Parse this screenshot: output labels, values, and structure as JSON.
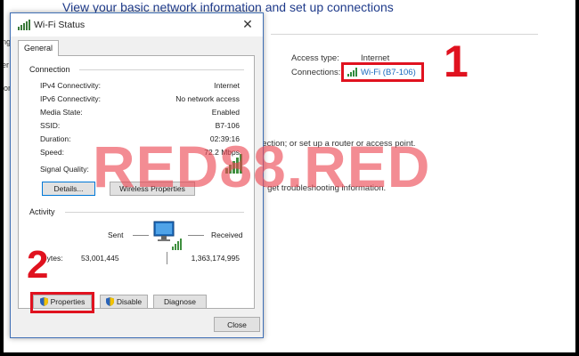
{
  "background": {
    "heading": "View your basic network information and set up connections",
    "left_fragments": [
      "ngs",
      "er",
      "ion"
    ],
    "access_type_label": "Access type:",
    "access_type_value": "Internet",
    "connections_label": "Connections:",
    "connection_link": "Wi-Fi (B7-106)",
    "text1": "nection; or set up a router or access point.",
    "text2": "or get troubleshooting information."
  },
  "dialog": {
    "title": "Wi-Fi Status",
    "tab": "General",
    "connection_section": "Connection",
    "rows": [
      {
        "label": "IPv4 Connectivity:",
        "value": "Internet"
      },
      {
        "label": "IPv6 Connectivity:",
        "value": "No network access"
      },
      {
        "label": "Media State:",
        "value": "Enabled"
      },
      {
        "label": "SSID:",
        "value": "B7-106"
      },
      {
        "label": "Duration:",
        "value": "02:39:16"
      },
      {
        "label": "Speed:",
        "value": "72.2 Mbps"
      }
    ],
    "signal_label": "Signal Quality:",
    "details_button": "Details...",
    "wireless_button": "Wireless Properties",
    "activity_section": "Activity",
    "sent_label": "Sent",
    "received_label": "Received",
    "bytes_label": "Bytes:",
    "bytes_sent": "53,001,445",
    "bytes_received": "1,363,174,995",
    "properties_button": "Properties",
    "disable_button": "Disable",
    "diagnose_button": "Diagnose",
    "close_button": "Close"
  },
  "annotations": {
    "step1": "1",
    "step2": "2",
    "highlight_color": "#e0121f"
  },
  "watermark": "RED88.RED",
  "icons": [
    "wifi-signal-icon",
    "close-icon",
    "signal-bars-icon",
    "network-computer-icon",
    "shield-icon"
  ]
}
